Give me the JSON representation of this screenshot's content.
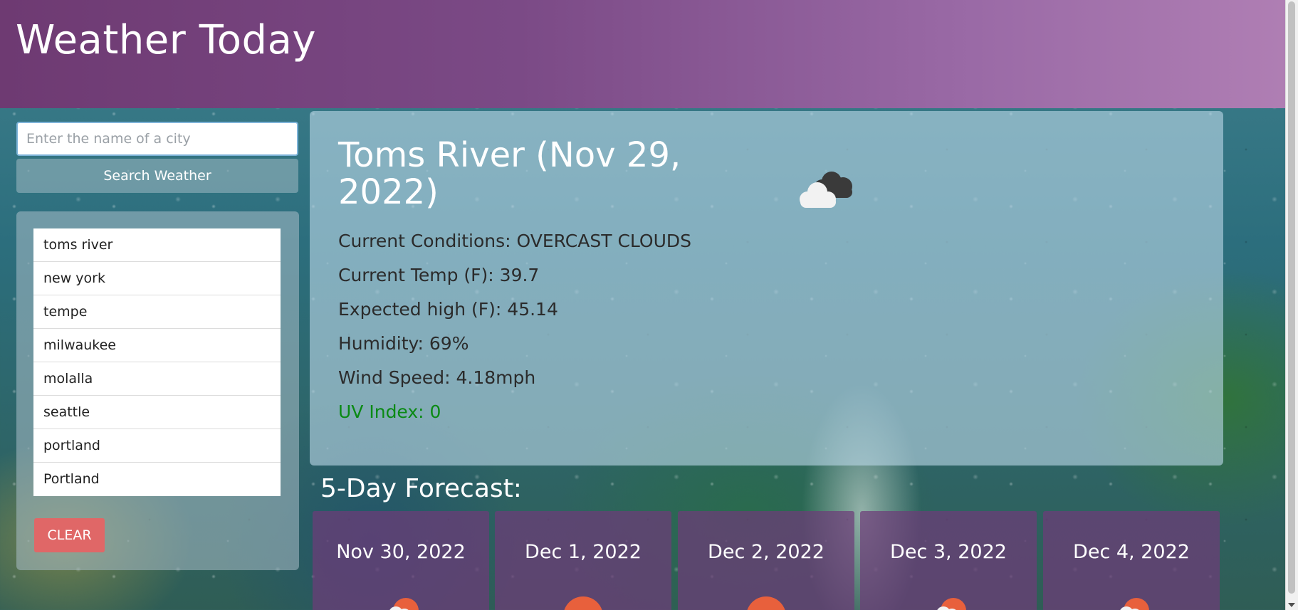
{
  "header": {
    "title": "Weather Today"
  },
  "search": {
    "placeholder": "Enter the name of a city",
    "value": "",
    "button_label": "Search Weather"
  },
  "history": {
    "items": [
      {
        "label": "toms river"
      },
      {
        "label": "new york"
      },
      {
        "label": "tempe"
      },
      {
        "label": "milwaukee"
      },
      {
        "label": "molalla"
      },
      {
        "label": "seattle"
      },
      {
        "label": "portland"
      },
      {
        "label": "Portland"
      }
    ],
    "clear_label": "CLEAR"
  },
  "current": {
    "title": "Toms River (Nov 29, 2022)",
    "icon": "overcast-clouds-icon",
    "conditions": "Current Conditions: OVERCAST CLOUDS",
    "temp": "Current Temp (F): 39.7",
    "high": "Expected high (F): 45.14",
    "humidity": "Humidity: 69%",
    "wind": "Wind Speed: 4.18mph",
    "uv": "UV Index: 0",
    "uv_color": "#0a8a14"
  },
  "forecast": {
    "heading": "5-Day Forecast:",
    "days": [
      {
        "date": "Nov 30, 2022",
        "icon": "partly-cloudy-icon"
      },
      {
        "date": "Dec 1, 2022",
        "icon": "sun-icon"
      },
      {
        "date": "Dec 2, 2022",
        "icon": "sun-icon"
      },
      {
        "date": "Dec 3, 2022",
        "icon": "partly-cloudy-icon"
      },
      {
        "date": "Dec 4, 2022",
        "icon": "partly-cloudy-icon"
      }
    ]
  },
  "colors": {
    "header_bg": "#7b4a86",
    "clear_button": "#e06767",
    "forecast_card": "#6e3c78"
  }
}
